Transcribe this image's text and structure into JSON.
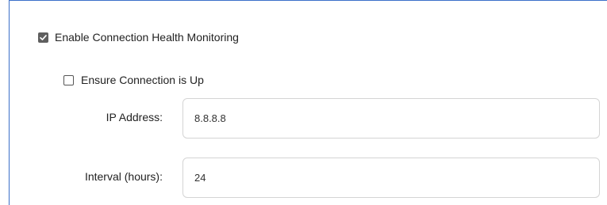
{
  "health_monitoring": {
    "enable_label": "Enable Connection Health Monitoring",
    "enable_checked": true
  },
  "ensure_up": {
    "label": "Ensure Connection is Up",
    "checked": false
  },
  "ip_address": {
    "label": "IP Address:",
    "value": "8.8.8.8"
  },
  "interval": {
    "label": "Interval (hours):",
    "value": "24"
  },
  "colors": {
    "accent_border": "#3b6fc9",
    "checkbox_checked": "#5f5f5f",
    "input_border": "#d4d4d4"
  },
  "icons": {
    "checkmark": "checkmark-icon"
  }
}
